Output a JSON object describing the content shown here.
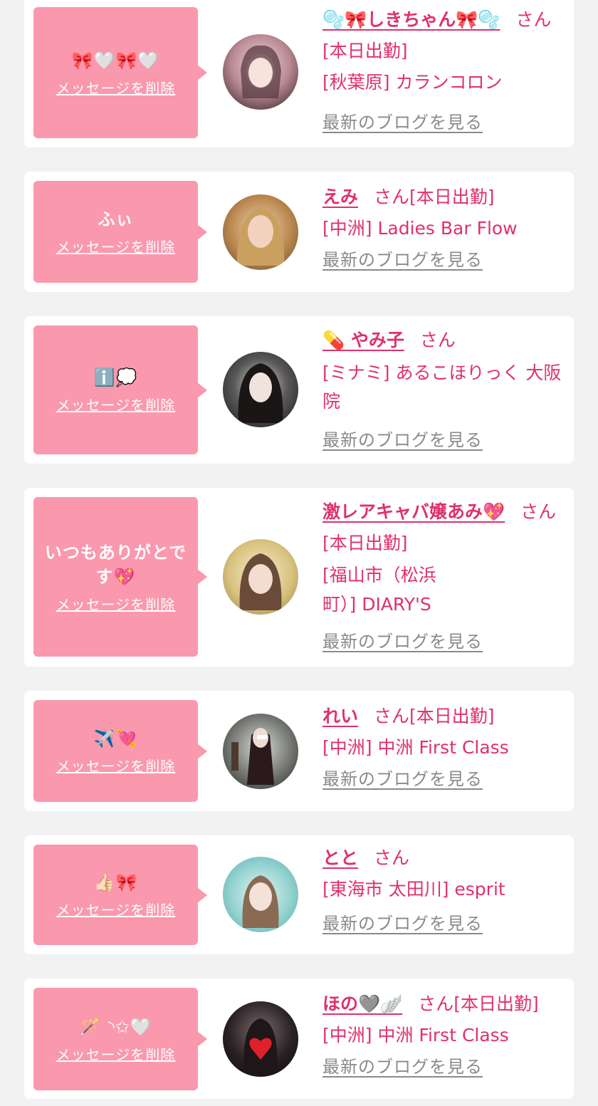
{
  "colors": {
    "page_bg": "#f2f2f2",
    "card_bg": "#ffffff",
    "bubble_bg": "#fa98ad",
    "accent": "#e0306c",
    "link_gray": "#8a8a8a"
  },
  "delete_label": "メッセージを削除",
  "blog_label": "最新のブログを見る",
  "cards": [
    {
      "message": "🎀🤍🎀🤍",
      "name": "🫧🎀しきちゃん🎀🫧",
      "san": "さん",
      "status": "[本日出勤]",
      "shop": "[秋葉原] カランコロン",
      "avatar_icon": "avatar-photo"
    },
    {
      "message": "ふぃ",
      "name": "えみ",
      "san": "さん",
      "status": "[本日出勤]",
      "shop": "[中洲] Ladies Bar Flow",
      "avatar_icon": "avatar-photo"
    },
    {
      "message": "ℹ️💭",
      "name": "💊 やみ子",
      "san": "さん",
      "status": "",
      "shop": "[ミナミ] あるこほりっく 大阪院",
      "avatar_icon": "avatar-photo"
    },
    {
      "message": "いつもありがとです💖",
      "name": "激レアキャバ嬢あみ💖",
      "san": "さん",
      "status": "[本日出勤]",
      "shop": "[福山市（松浜町）] DIARY'S",
      "avatar_icon": "avatar-photo"
    },
    {
      "message": "✈️💘",
      "name": "れい",
      "san": "さん",
      "status": "[本日出勤]",
      "shop": "[中洲] 中洲 First Class",
      "avatar_icon": "avatar-photo"
    },
    {
      "message": "👍🏻🎀",
      "name": "とと",
      "san": "さん",
      "status": "",
      "shop": "[東海市 太田川] esprit",
      "avatar_icon": "avatar-photo"
    },
    {
      "message": "🪄 ◝✩🤍",
      "name": "ほの🩶🪽",
      "san": "さん",
      "status": "[本日出勤]",
      "shop": "[中洲] 中洲 First Class",
      "avatar_icon": "avatar-photo"
    }
  ]
}
